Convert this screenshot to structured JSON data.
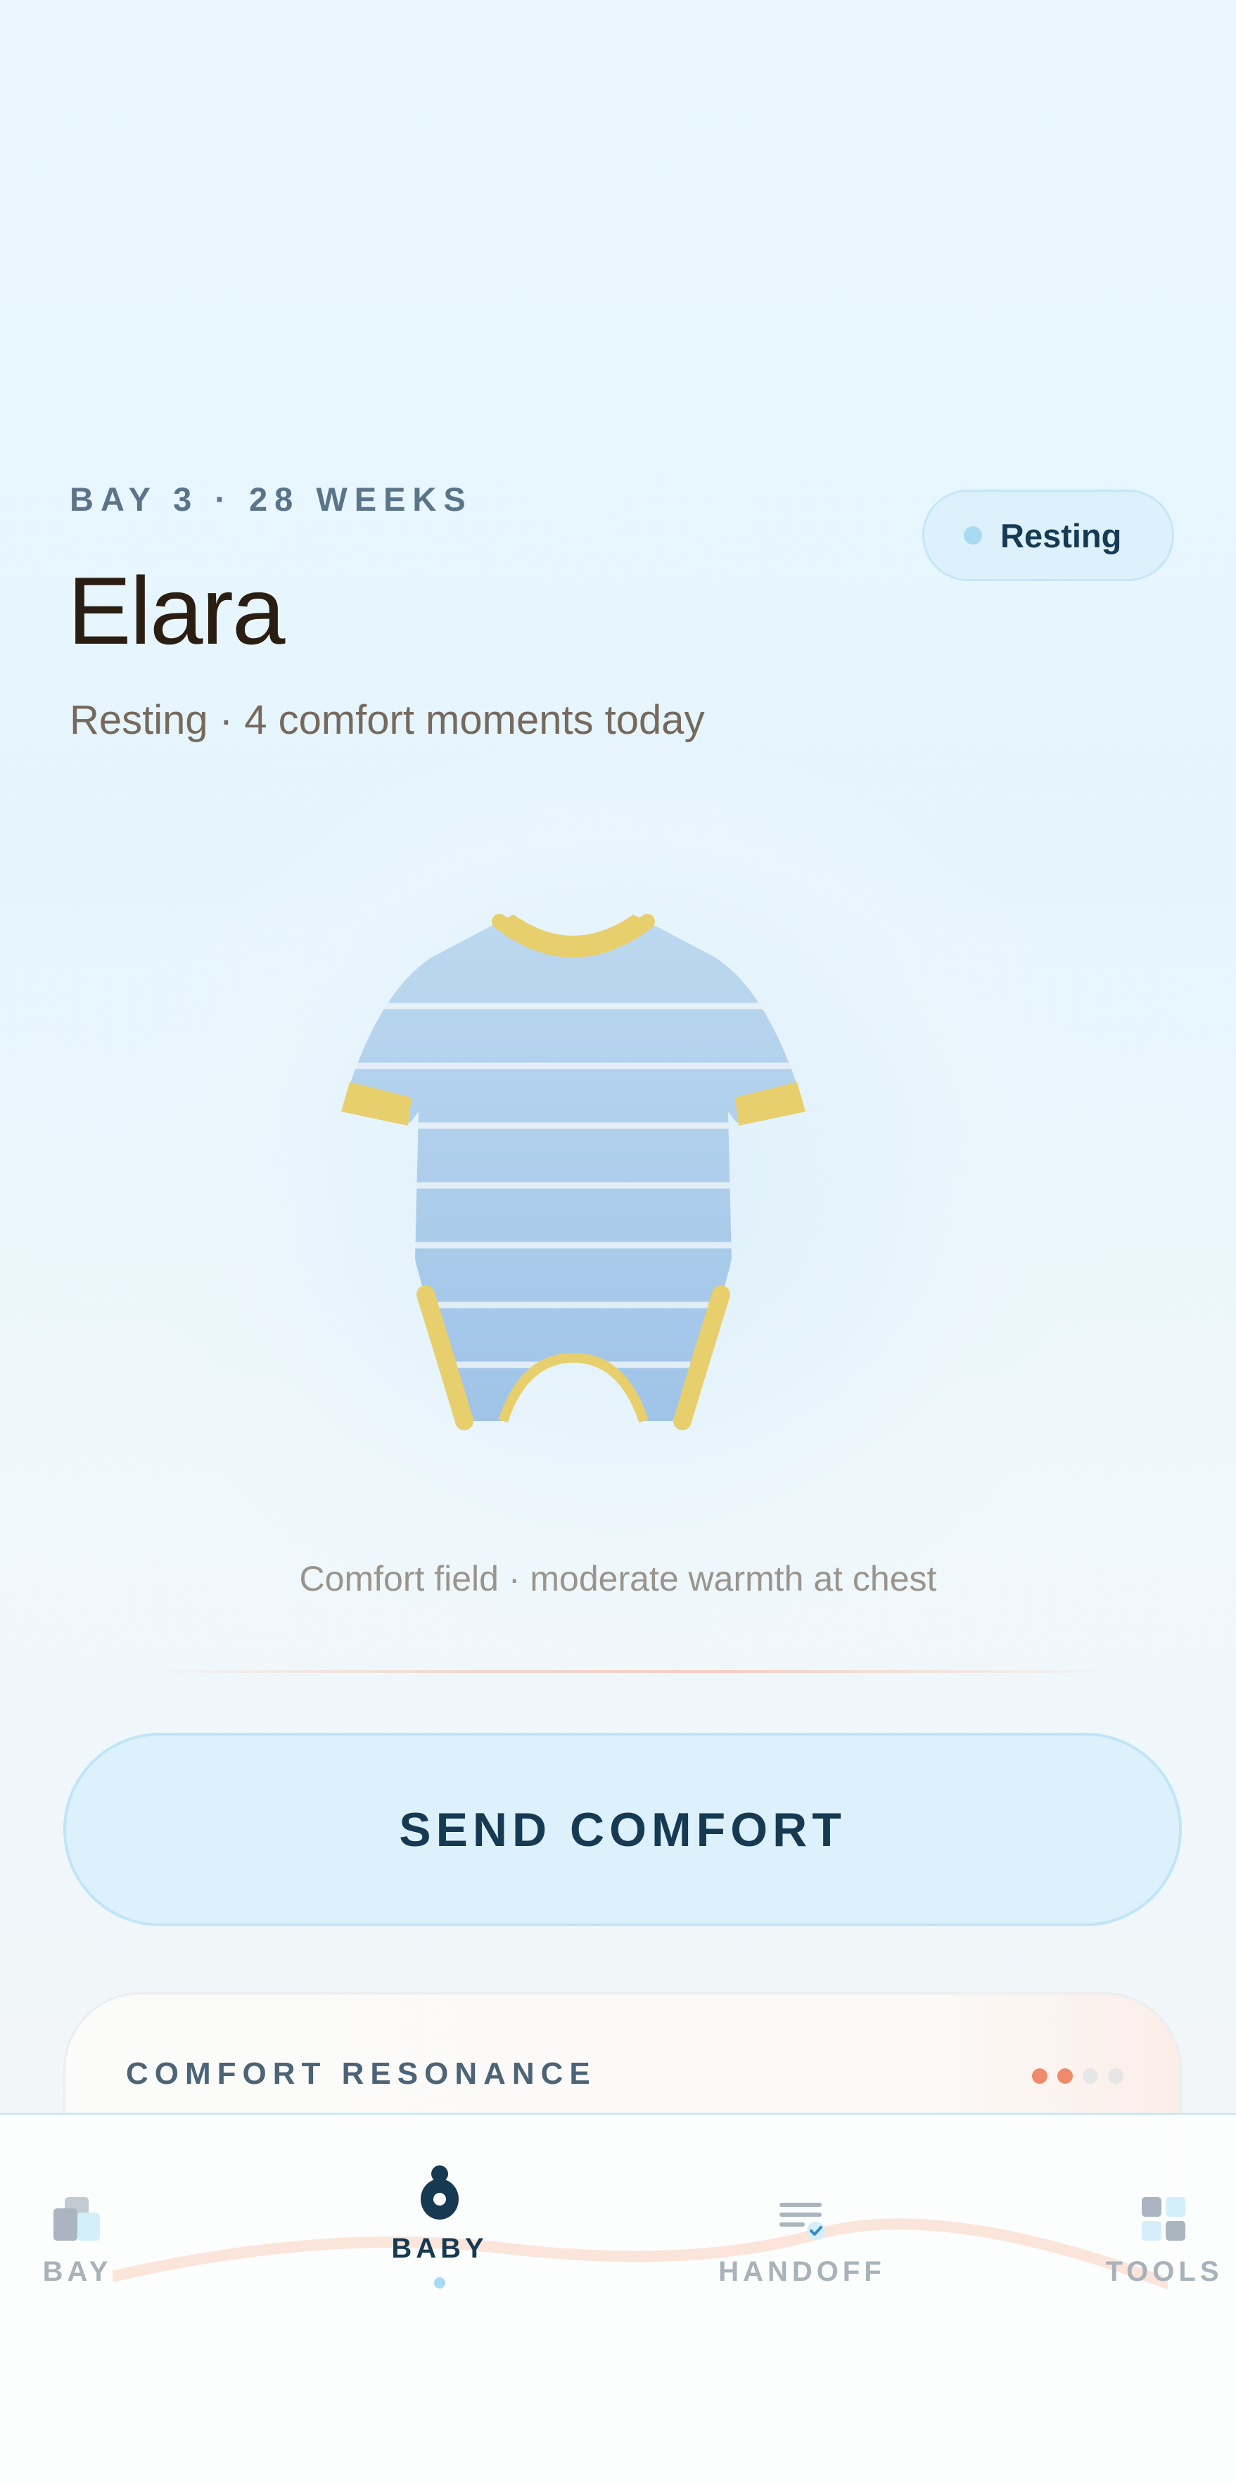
{
  "header": {
    "eyebrow": "BAY 3 · 28 WEEKS",
    "baby_name": "Elara",
    "subtitle": "Resting · 4 comfort moments today",
    "status_chip": "Resting"
  },
  "illustration": {
    "icon": "baby-onesie-icon"
  },
  "comfort": {
    "caption": "Comfort field · moderate warmth at chest",
    "send_button": "SEND COMFORT"
  },
  "resonance": {
    "label": "COMFORT RESONANCE",
    "level": 2,
    "max_level": 4
  },
  "tabs": [
    {
      "label": "BAY",
      "icon": "bay-grid-icon",
      "active": false
    },
    {
      "label": "BABY",
      "icon": "baby-icon",
      "active": true
    },
    {
      "label": "HANDOFF",
      "icon": "handoff-checklist-icon",
      "active": false
    },
    {
      "label": "TOOLS",
      "icon": "tools-grid-icon",
      "active": false
    }
  ],
  "colors": {
    "accent": "#163a52",
    "chip_bg": "#dcf1fb",
    "resonance_active": "#ef8a6a",
    "resonance_inactive": "#e6e6e6"
  }
}
